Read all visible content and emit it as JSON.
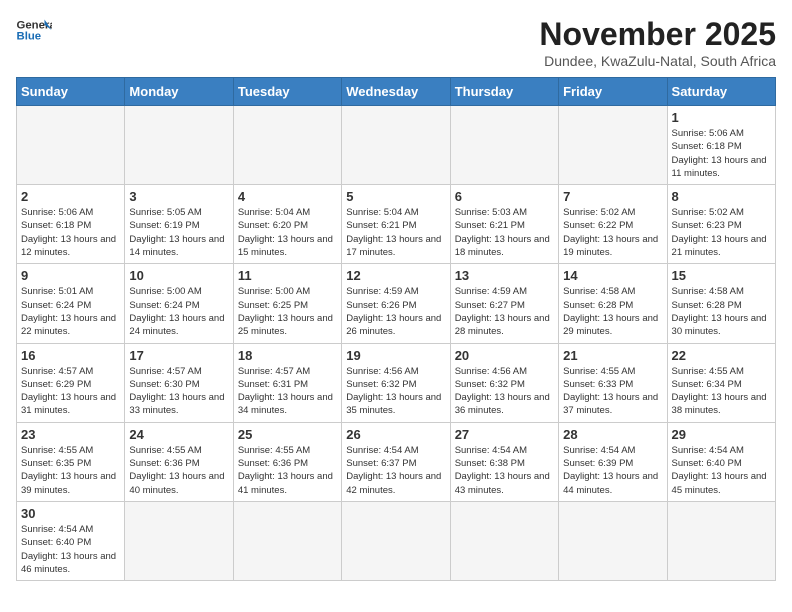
{
  "header": {
    "logo_general": "General",
    "logo_blue": "Blue",
    "month_title": "November 2025",
    "location": "Dundee, KwaZulu-Natal, South Africa"
  },
  "days_of_week": [
    "Sunday",
    "Monday",
    "Tuesday",
    "Wednesday",
    "Thursday",
    "Friday",
    "Saturday"
  ],
  "weeks": [
    [
      {
        "day": "",
        "info": ""
      },
      {
        "day": "",
        "info": ""
      },
      {
        "day": "",
        "info": ""
      },
      {
        "day": "",
        "info": ""
      },
      {
        "day": "",
        "info": ""
      },
      {
        "day": "",
        "info": ""
      },
      {
        "day": "1",
        "info": "Sunrise: 5:06 AM\nSunset: 6:18 PM\nDaylight: 13 hours and 11 minutes."
      }
    ],
    [
      {
        "day": "2",
        "info": "Sunrise: 5:06 AM\nSunset: 6:18 PM\nDaylight: 13 hours and 12 minutes."
      },
      {
        "day": "3",
        "info": "Sunrise: 5:05 AM\nSunset: 6:19 PM\nDaylight: 13 hours and 14 minutes."
      },
      {
        "day": "4",
        "info": "Sunrise: 5:04 AM\nSunset: 6:20 PM\nDaylight: 13 hours and 15 minutes."
      },
      {
        "day": "5",
        "info": "Sunrise: 5:04 AM\nSunset: 6:21 PM\nDaylight: 13 hours and 17 minutes."
      },
      {
        "day": "6",
        "info": "Sunrise: 5:03 AM\nSunset: 6:21 PM\nDaylight: 13 hours and 18 minutes."
      },
      {
        "day": "7",
        "info": "Sunrise: 5:02 AM\nSunset: 6:22 PM\nDaylight: 13 hours and 19 minutes."
      },
      {
        "day": "8",
        "info": "Sunrise: 5:02 AM\nSunset: 6:23 PM\nDaylight: 13 hours and 21 minutes."
      }
    ],
    [
      {
        "day": "9",
        "info": "Sunrise: 5:01 AM\nSunset: 6:24 PM\nDaylight: 13 hours and 22 minutes."
      },
      {
        "day": "10",
        "info": "Sunrise: 5:00 AM\nSunset: 6:24 PM\nDaylight: 13 hours and 24 minutes."
      },
      {
        "day": "11",
        "info": "Sunrise: 5:00 AM\nSunset: 6:25 PM\nDaylight: 13 hours and 25 minutes."
      },
      {
        "day": "12",
        "info": "Sunrise: 4:59 AM\nSunset: 6:26 PM\nDaylight: 13 hours and 26 minutes."
      },
      {
        "day": "13",
        "info": "Sunrise: 4:59 AM\nSunset: 6:27 PM\nDaylight: 13 hours and 28 minutes."
      },
      {
        "day": "14",
        "info": "Sunrise: 4:58 AM\nSunset: 6:28 PM\nDaylight: 13 hours and 29 minutes."
      },
      {
        "day": "15",
        "info": "Sunrise: 4:58 AM\nSunset: 6:28 PM\nDaylight: 13 hours and 30 minutes."
      }
    ],
    [
      {
        "day": "16",
        "info": "Sunrise: 4:57 AM\nSunset: 6:29 PM\nDaylight: 13 hours and 31 minutes."
      },
      {
        "day": "17",
        "info": "Sunrise: 4:57 AM\nSunset: 6:30 PM\nDaylight: 13 hours and 33 minutes."
      },
      {
        "day": "18",
        "info": "Sunrise: 4:57 AM\nSunset: 6:31 PM\nDaylight: 13 hours and 34 minutes."
      },
      {
        "day": "19",
        "info": "Sunrise: 4:56 AM\nSunset: 6:32 PM\nDaylight: 13 hours and 35 minutes."
      },
      {
        "day": "20",
        "info": "Sunrise: 4:56 AM\nSunset: 6:32 PM\nDaylight: 13 hours and 36 minutes."
      },
      {
        "day": "21",
        "info": "Sunrise: 4:55 AM\nSunset: 6:33 PM\nDaylight: 13 hours and 37 minutes."
      },
      {
        "day": "22",
        "info": "Sunrise: 4:55 AM\nSunset: 6:34 PM\nDaylight: 13 hours and 38 minutes."
      }
    ],
    [
      {
        "day": "23",
        "info": "Sunrise: 4:55 AM\nSunset: 6:35 PM\nDaylight: 13 hours and 39 minutes."
      },
      {
        "day": "24",
        "info": "Sunrise: 4:55 AM\nSunset: 6:36 PM\nDaylight: 13 hours and 40 minutes."
      },
      {
        "day": "25",
        "info": "Sunrise: 4:55 AM\nSunset: 6:36 PM\nDaylight: 13 hours and 41 minutes."
      },
      {
        "day": "26",
        "info": "Sunrise: 4:54 AM\nSunset: 6:37 PM\nDaylight: 13 hours and 42 minutes."
      },
      {
        "day": "27",
        "info": "Sunrise: 4:54 AM\nSunset: 6:38 PM\nDaylight: 13 hours and 43 minutes."
      },
      {
        "day": "28",
        "info": "Sunrise: 4:54 AM\nSunset: 6:39 PM\nDaylight: 13 hours and 44 minutes."
      },
      {
        "day": "29",
        "info": "Sunrise: 4:54 AM\nSunset: 6:40 PM\nDaylight: 13 hours and 45 minutes."
      }
    ],
    [
      {
        "day": "30",
        "info": "Sunrise: 4:54 AM\nSunset: 6:40 PM\nDaylight: 13 hours and 46 minutes."
      },
      {
        "day": "",
        "info": ""
      },
      {
        "day": "",
        "info": ""
      },
      {
        "day": "",
        "info": ""
      },
      {
        "day": "",
        "info": ""
      },
      {
        "day": "",
        "info": ""
      },
      {
        "day": "",
        "info": ""
      }
    ]
  ]
}
